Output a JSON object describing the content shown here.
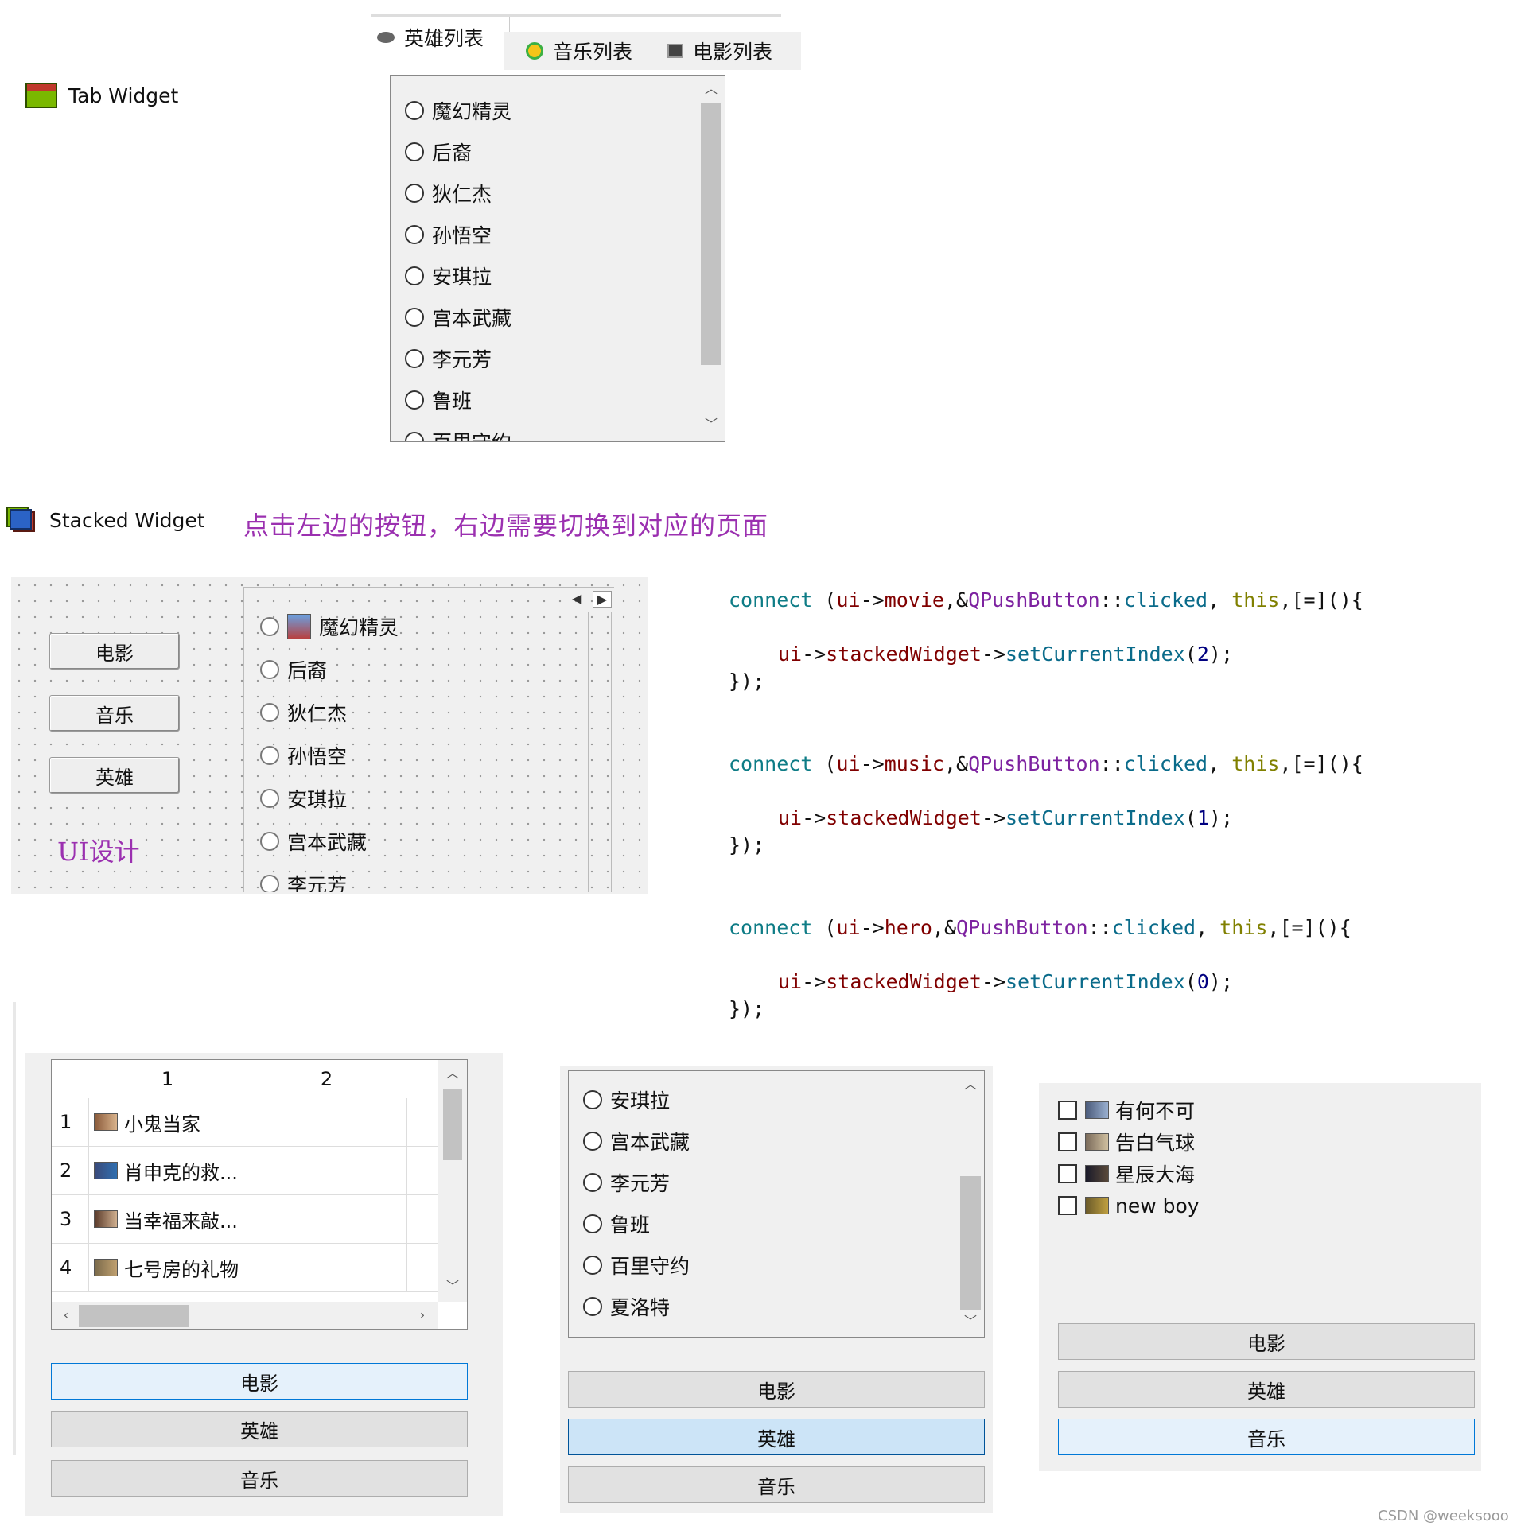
{
  "tab_widget": {
    "label": "Tab Widget",
    "icon": "tab-widget-icon",
    "tabs": [
      {
        "label": "英雄列表",
        "icon": "hero-icon"
      },
      {
        "label": "音乐列表",
        "icon": "music-icon"
      },
      {
        "label": "电影列表",
        "icon": "film-icon"
      }
    ],
    "heroes": [
      "魔幻精灵",
      "后裔",
      "狄仁杰",
      "孙悟空",
      "安琪拉",
      "宫本武藏",
      "李元芳",
      "鲁班",
      "百里守约"
    ]
  },
  "stacked_widget": {
    "label": "Stacked Widget",
    "icon": "stacked-widget-icon",
    "annotation": "点击左边的按钮，右边需要切换到对应的页面",
    "design": {
      "buttons": [
        "电影",
        "音乐",
        "英雄"
      ],
      "caption": "UI设计",
      "heroes": [
        "魔幻精灵",
        "后裔",
        "狄仁杰",
        "孙悟空",
        "安琪拉",
        "宫本武藏",
        "李元芳"
      ]
    }
  },
  "code": [
    {
      "obj": "movie",
      "index": "2"
    },
    {
      "obj": "music",
      "index": "1"
    },
    {
      "obj": "hero",
      "index": "0"
    }
  ],
  "code_tokens": {
    "connect": "connect",
    "ui": "ui",
    "pushbutton": "QPushButton",
    "clicked": "clicked",
    "this": "this",
    "stacked": "stackedWidget",
    "setindex": "setCurrentIndex"
  },
  "demo_movie": {
    "columns": [
      "1",
      "2"
    ],
    "rows": [
      {
        "num": "1",
        "title": "小鬼当家"
      },
      {
        "num": "2",
        "title": "肖申克的救..."
      },
      {
        "num": "3",
        "title": "当幸福来敲..."
      },
      {
        "num": "4",
        "title": "七号房的礼物"
      }
    ],
    "buttons": [
      "电影",
      "英雄",
      "音乐"
    ]
  },
  "demo_hero": {
    "heroes": [
      "安琪拉",
      "宫本武藏",
      "李元芳",
      "鲁班",
      "百里守约",
      "夏洛特"
    ],
    "buttons": [
      "电影",
      "英雄",
      "音乐"
    ]
  },
  "demo_music": {
    "songs": [
      "有何不可",
      "告白气球",
      "星辰大海",
      "new boy"
    ],
    "buttons": [
      "电影",
      "英雄",
      "音乐"
    ]
  },
  "watermark": "CSDN @weeksooo",
  "colors": {
    "purple_annotation": "#9b30b0",
    "highlight_border": "#0078d7",
    "selected_fill": "#cce4f7"
  }
}
